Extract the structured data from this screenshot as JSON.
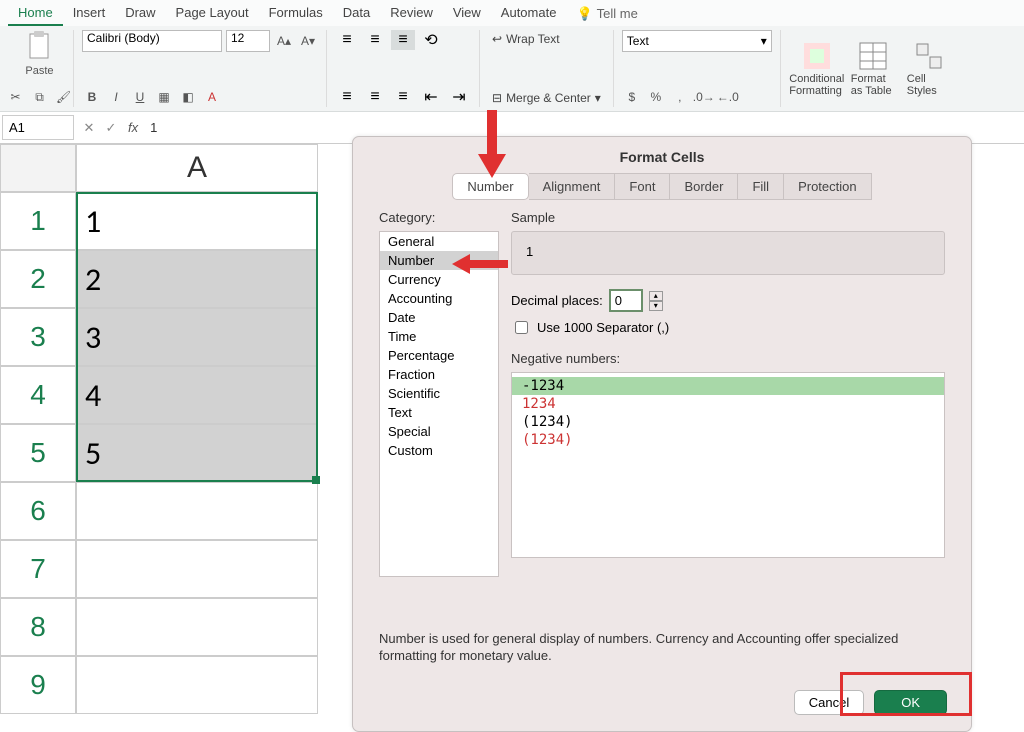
{
  "tabs": {
    "home": "Home",
    "insert": "Insert",
    "draw": "Draw",
    "layout": "Page Layout",
    "formulas": "Formulas",
    "data": "Data",
    "review": "Review",
    "view": "View",
    "automate": "Automate",
    "tellme": "Tell me"
  },
  "ribbon": {
    "paste": "Paste",
    "font_name": "Calibri (Body)",
    "font_size": "12",
    "wrap": "Wrap Text",
    "merge": "Merge & Center",
    "num_format": "Text",
    "cond": "Conditional Formatting",
    "as_table": "Format as Table",
    "styles": "Cell Styles"
  },
  "fbar": {
    "ref": "A1",
    "val": "1"
  },
  "sheet": {
    "col_a": "A",
    "rows": [
      "1",
      "2",
      "3",
      "4",
      "5",
      "6",
      "7",
      "8",
      "9"
    ],
    "cells": [
      "1",
      "2",
      "3",
      "4",
      "5",
      "",
      "",
      "",
      ""
    ]
  },
  "dialog": {
    "title": "Format Cells",
    "tabs": {
      "number": "Number",
      "alignment": "Alignment",
      "font": "Font",
      "border": "Border",
      "fill": "Fill",
      "protection": "Protection"
    },
    "category_label": "Category:",
    "categories": [
      "General",
      "Number",
      "Currency",
      "Accounting",
      "Date",
      "Time",
      "Percentage",
      "Fraction",
      "Scientific",
      "Text",
      "Special",
      "Custom"
    ],
    "sample_label": "Sample",
    "sample_value": "1",
    "decimal_label": "Decimal places:",
    "decimal_value": "0",
    "separator_label": "Use 1000 Separator (,)",
    "negative_label": "Negative numbers:",
    "negatives": [
      "-1234",
      "1234",
      "(1234)",
      "(1234)"
    ],
    "desc": "Number is used for general display of numbers.  Currency and Accounting offer specialized formatting for monetary value.",
    "cancel": "Cancel",
    "ok": "OK"
  }
}
